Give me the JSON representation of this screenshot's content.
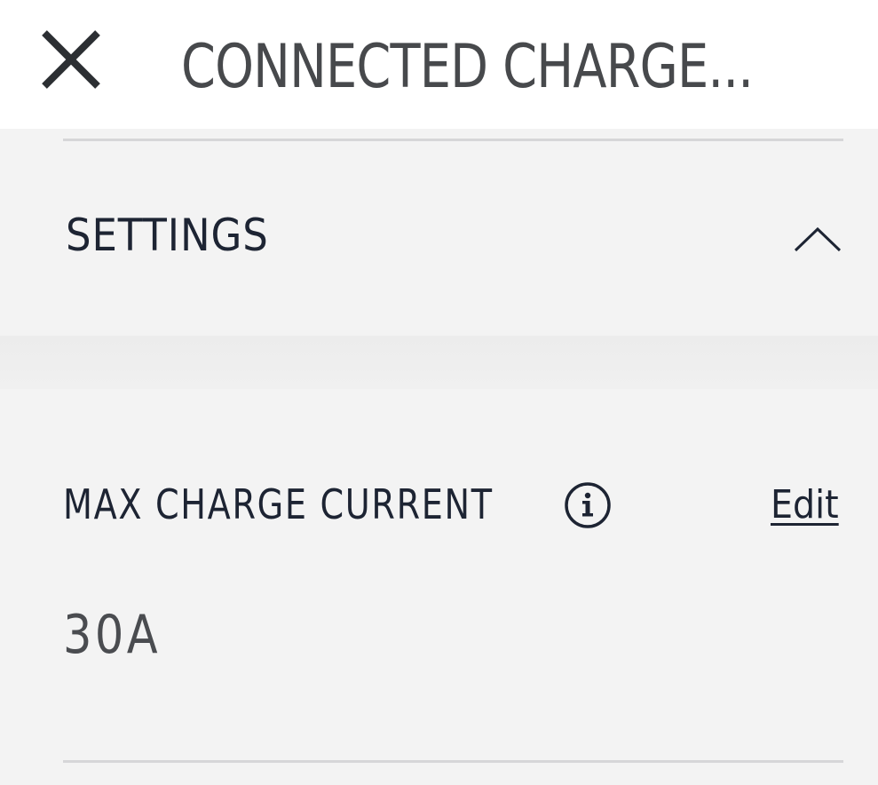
{
  "header": {
    "title": "CONNECTED CHARGE...",
    "close_icon": "close-icon"
  },
  "settings": {
    "title": "SETTINGS",
    "toggle_icon": "chevron-up-icon",
    "expanded": true
  },
  "max_charge_current": {
    "label": "MAX CHARGE CURRENT",
    "info_icon": "info-icon",
    "edit_label": "Edit",
    "value": "30A"
  },
  "colors": {
    "text_dark": "#1d2433",
    "text_gray": "#47494c",
    "background": "#f3f3f3",
    "header_background": "#ffffff",
    "divider": "#d6d6d8"
  }
}
